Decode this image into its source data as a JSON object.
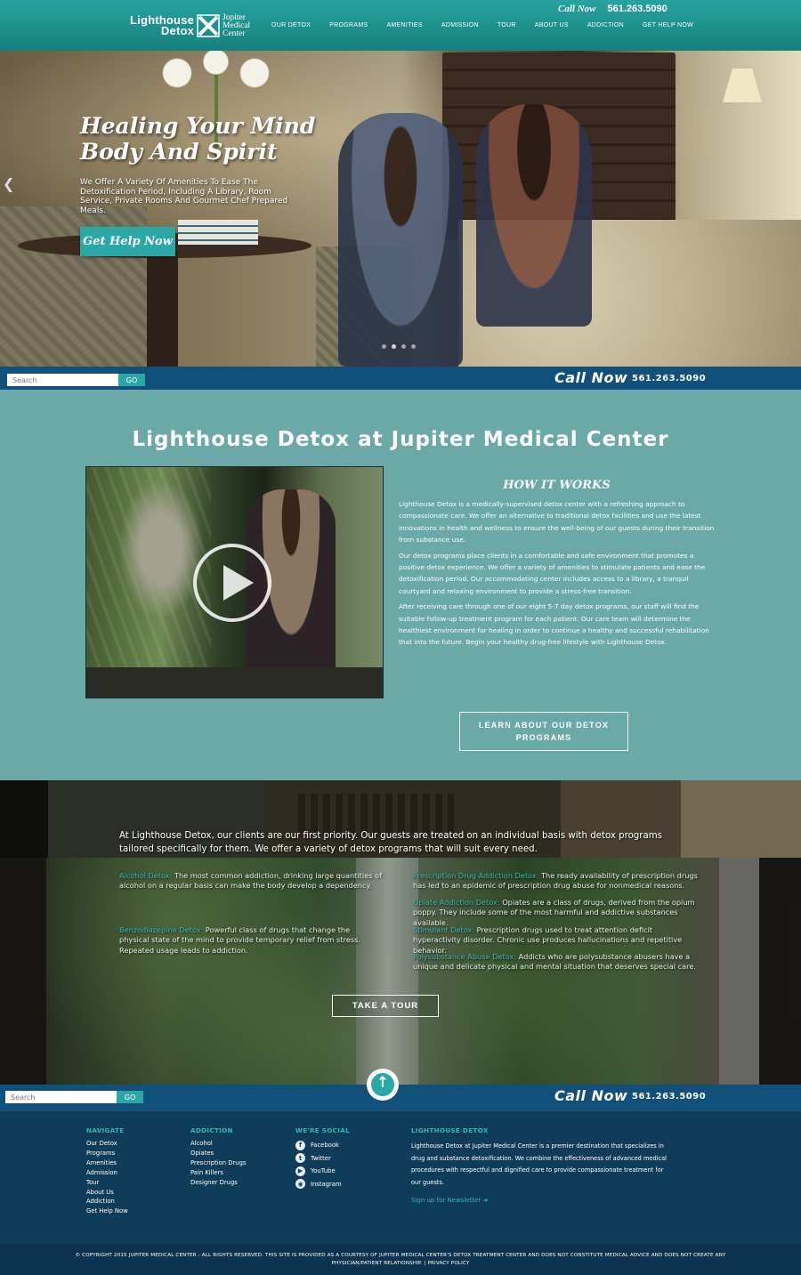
{
  "header": {
    "logo_left_line1": "Lighthouse",
    "logo_left_line2": "Detox",
    "logo_right_line1": "Jupiter",
    "logo_right_line2": "Medical",
    "logo_right_line3": "Center",
    "call_label": "Call Now",
    "phone": "561.263.5090",
    "nav": [
      "OUR DETOX",
      "PROGRAMS",
      "AMENITIES",
      "ADMISSION",
      "TOUR",
      "ABOUT US",
      "ADDICTION",
      "GET HELP NOW"
    ]
  },
  "hero": {
    "title_line1": "Healing Your Mind",
    "title_line2": "Body And Spirit",
    "subtitle": "We Offer A Variety Of Amenities To Ease The Detoxification Period, Including A Library, Room Service, Private Rooms And Gourmet Chef Prepared Meals.",
    "cta": "Get Help Now",
    "prev_icon": "chevron-left-icon",
    "active_slide": 2,
    "slide_count": 4
  },
  "search_bar": {
    "placeholder": "Search",
    "go_label": "GO",
    "call_label": "Call Now",
    "phone": "561.263.5090"
  },
  "intro": {
    "heading": "Lighthouse Detox at Jupiter Medical Center",
    "how_heading": "HOW IT WORKS",
    "paragraphs": [
      "Lighthouse Detox is a medically-supervised detox center with a refreshing approach to compassionate care. We offer an alternative to traditional detox facilities and use the latest innovations in health and wellness to ensure the well-being of our guests during their transition from substance use.",
      "Our detox programs place clients in a comfortable and safe environment that promotes a positive detox experience. We offer a variety of amenities to stimulate patients and ease the detoxification period. Our accommodating center includes access to a library, a tranquil courtyard and relaxing environment to provide a stress-free transition.",
      "After receiving care through one of our eight 5-7 day detox programs, our staff will find the suitable follow-up treatment program for each patient. Our care team will determine the healthiest environment for healing in order to continue a healthy and successful rehabilitation that into the future. Begin your healthy drug-free lifestyle with Lighthouse Detox."
    ],
    "learn_button": "LEARN ABOUT OUR DETOX PROGRAMS"
  },
  "programs": {
    "intro": "At Lighthouse Detox, our clients are our first priority. Our guests are treated on an individual basis with detox programs tailored specifically for them. We offer a variety of detox programs that will suit every need.",
    "items": [
      {
        "link": "Alcohol Detox:",
        "text": " The most common addiction, drinking large quantities of alcohol on a regular basis can make the body develop a dependency."
      },
      {
        "link": "Benzodiazepine Detox:",
        "text": " Powerful class of drugs that change the physical state of the mind to provide temporary relief from stress. Repeated usage leads to addiction."
      },
      {
        "link": "Prescription Drug Addiction Detox:",
        "text": " The ready availability of prescription drugs has led to an epidemic of prescription drug abuse for nonmedical reasons."
      },
      {
        "link": "Opiate Addiction Detox:",
        "text": " Opiates are a class of drugs, derived from the opium poppy. They include some of the most harmful and addictive substances available."
      },
      {
        "link": "Stimulant Detox:",
        "text": " Prescription drugs used to treat attention deficit hyperactivity disorder. Chronic use produces hallucinations and repetitive behavior."
      },
      {
        "link": "Polysubstance Abuse Detox:",
        "text": " Addicts who are polysubstance abusers have a unique and delicate physical and mental situation that deserves special care."
      }
    ],
    "tour_button": "TAKE A TOUR"
  },
  "footer": {
    "navigate_heading": "NAVIGATE",
    "navigate": [
      "Our Detox",
      "Programs",
      "Amenities",
      "Admission",
      "Tour",
      "About Us",
      "Addiction",
      "Get Help Now"
    ],
    "addiction_heading": "ADDICTION",
    "addiction": [
      "Alcohol",
      "Opiates",
      "Prescription Drugs",
      "Pain Killers",
      "Designer Drugs"
    ],
    "social_heading": "WE'RE SOCIAL",
    "social": [
      {
        "name": "Facebook",
        "icon": "facebook-icon",
        "glyph": "f"
      },
      {
        "name": "Twitter",
        "icon": "twitter-icon",
        "glyph": "t"
      },
      {
        "name": "YouTube",
        "icon": "youtube-icon",
        "glyph": "▶"
      },
      {
        "name": "Instagram",
        "icon": "instagram-icon",
        "glyph": "◉"
      }
    ],
    "about_heading": "LIGHTHOUSE DETOX",
    "about_text": "Lighthouse Detox at Jupiter Medical Center is a premier destination that specializes in drug and substance detoxification. We combine the effectiveness of advanced medical procedures with respectful and dignified care to provide compassionate treatment for our guests.",
    "newsletter": "Sign up for Newsletter ➜",
    "copyright": "© COPYRIGHT 2015 JUPITER MEDICAL CENTER - ALL RIGHTS RESERVED. THIS SITE IS PROVIDED AS A COURTESY OF JUPITER MEDICAL CENTER'S DETOX TREATMENT CENTER AND DOES NOT CONSTITUTE MEDICAL ADVICE AND DOES NOT CREATE ANY PHYSICIAN/PATIENT RELATIONSHIP. | PRIVACY POLICY"
  },
  "colors": {
    "teal": "#2ba8a5",
    "header_teal": "#1d8f8b",
    "section_teal": "#6aa9a8",
    "navy": "#10507a",
    "footer_navy": "#0f3d59"
  }
}
